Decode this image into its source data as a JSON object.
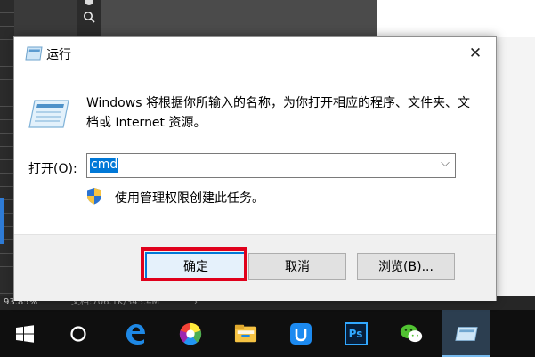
{
  "background": {
    "zoom": "93.85%",
    "doc_info": "文档:706.1K/345.4M",
    "status_arrow": "›",
    "tool_icons": [
      "ellipse-tool-icon",
      "zoom-tool-icon"
    ]
  },
  "dialog": {
    "title": "运行",
    "close_glyph": "✕",
    "description": "Windows 将根据你所输入的名称，为你打开相应的程序、文件夹、文档或 Internet 资源。",
    "open_label": "打开(O):",
    "open_value": "cmd",
    "dropdown_glyph": "⌵",
    "admin_note": "使用管理权限创建此任务。",
    "buttons": {
      "ok": "确定",
      "cancel": "取消",
      "browse": "浏览(B)..."
    },
    "highlight_color": "#e0001b"
  },
  "taskbar": {
    "items": [
      {
        "name": "start-windows-icon"
      },
      {
        "name": "cortana-circle-icon"
      },
      {
        "name": "edge-browser-icon"
      },
      {
        "name": "colorful-app-icon"
      },
      {
        "name": "file-explorer-icon"
      },
      {
        "name": "blue-app-icon"
      },
      {
        "name": "photoshop-icon",
        "label": "Ps"
      },
      {
        "name": "wechat-icon"
      },
      {
        "name": "run-dialog-taskbar-icon"
      }
    ]
  }
}
